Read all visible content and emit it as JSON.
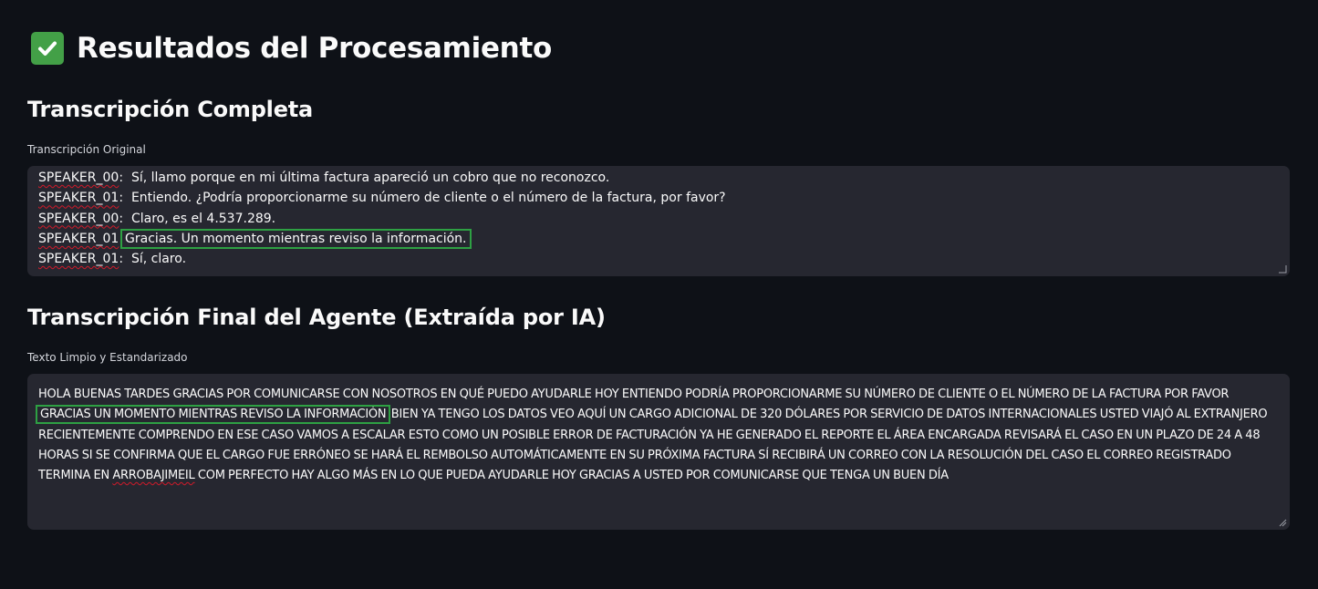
{
  "header": {
    "icon": "check-mark-button-icon",
    "title": "Resultados del Procesamiento"
  },
  "transcription": {
    "section_title": "Transcripción Completa",
    "field_label": "Transcripción Original",
    "lines": [
      {
        "speaker": "SPEAKER_00",
        "text": "Sí, llamo porque en mi última factura apareció un cobro que no reconozco."
      },
      {
        "speaker": "SPEAKER_01",
        "text": "Entiendo. ¿Podría proporcionarme su número de cliente o el número de la factura, por favor?"
      },
      {
        "speaker": "SPEAKER_00",
        "text": "Claro, es el 4.537.289."
      },
      {
        "speaker": "SPEAKER_01",
        "text": "Gracias. Un momento mientras reviso la información."
      },
      {
        "speaker": "SPEAKER_01",
        "text": "Sí, claro."
      }
    ]
  },
  "agent": {
    "section_title": "Transcripción Final del Agente (Extraída por IA)",
    "field_label": "Texto Limpio y Estandarizado",
    "text_before": "HOLA BUENAS TARDES GRACIAS POR COMUNICARSE CON NOSOTROS EN QUÉ PUEDO AYUDARLE HOY ENTIENDO PODRÍA PROPORCIONARME SU NÚMERO DE CLIENTE O EL NÚMERO DE LA FACTURA POR FAVOR ",
    "text_highlight": "GRACIAS UN MOMENTO MIENTRAS REVISO LA INFORMACIÓN",
    "text_middle": " BIEN YA TENGO LOS DATOS VEO AQUÍ UN CARGO ADICIONAL DE 320 DÓLARES POR SERVICIO DE DATOS INTERNACIONALES USTED VIAJÓ AL EXTRANJERO RECIENTEMENTE COMPRENDO EN ESE CASO VAMOS A ESCALAR ESTO COMO UN POSIBLE ERROR DE FACTURACIÓN YA HE GENERADO EL REPORTE EL ÁREA ENCARGADA REVISARÁ EL CASO EN UN PLAZO DE 24 A 48 HORAS SI SE CONFIRMA QUE EL CARGO FUE ERRÓNEO SE HARÁ EL REMBOLSO AUTOMÁTICAMENTE EN SU PRÓXIMA FACTURA SÍ RECIBIRÁ UN CORREO CON LA RESOLUCIÓN DEL CASO EL CORREO REGISTRADO TERMINA EN ",
    "text_squiggle": "ARROBAJIMEIL",
    "text_after": " COM PERFECTO HAY ALGO MÁS EN LO QUE PUEDA AYUDARLE HOY GRACIAS A USTED POR COMUNICARSE QUE TENGA UN BUEN DÍA"
  },
  "colors": {
    "background": "#0e1117",
    "textarea": "#262730",
    "highlight": "#2ea043",
    "spellcheck": "#d11a2a"
  }
}
